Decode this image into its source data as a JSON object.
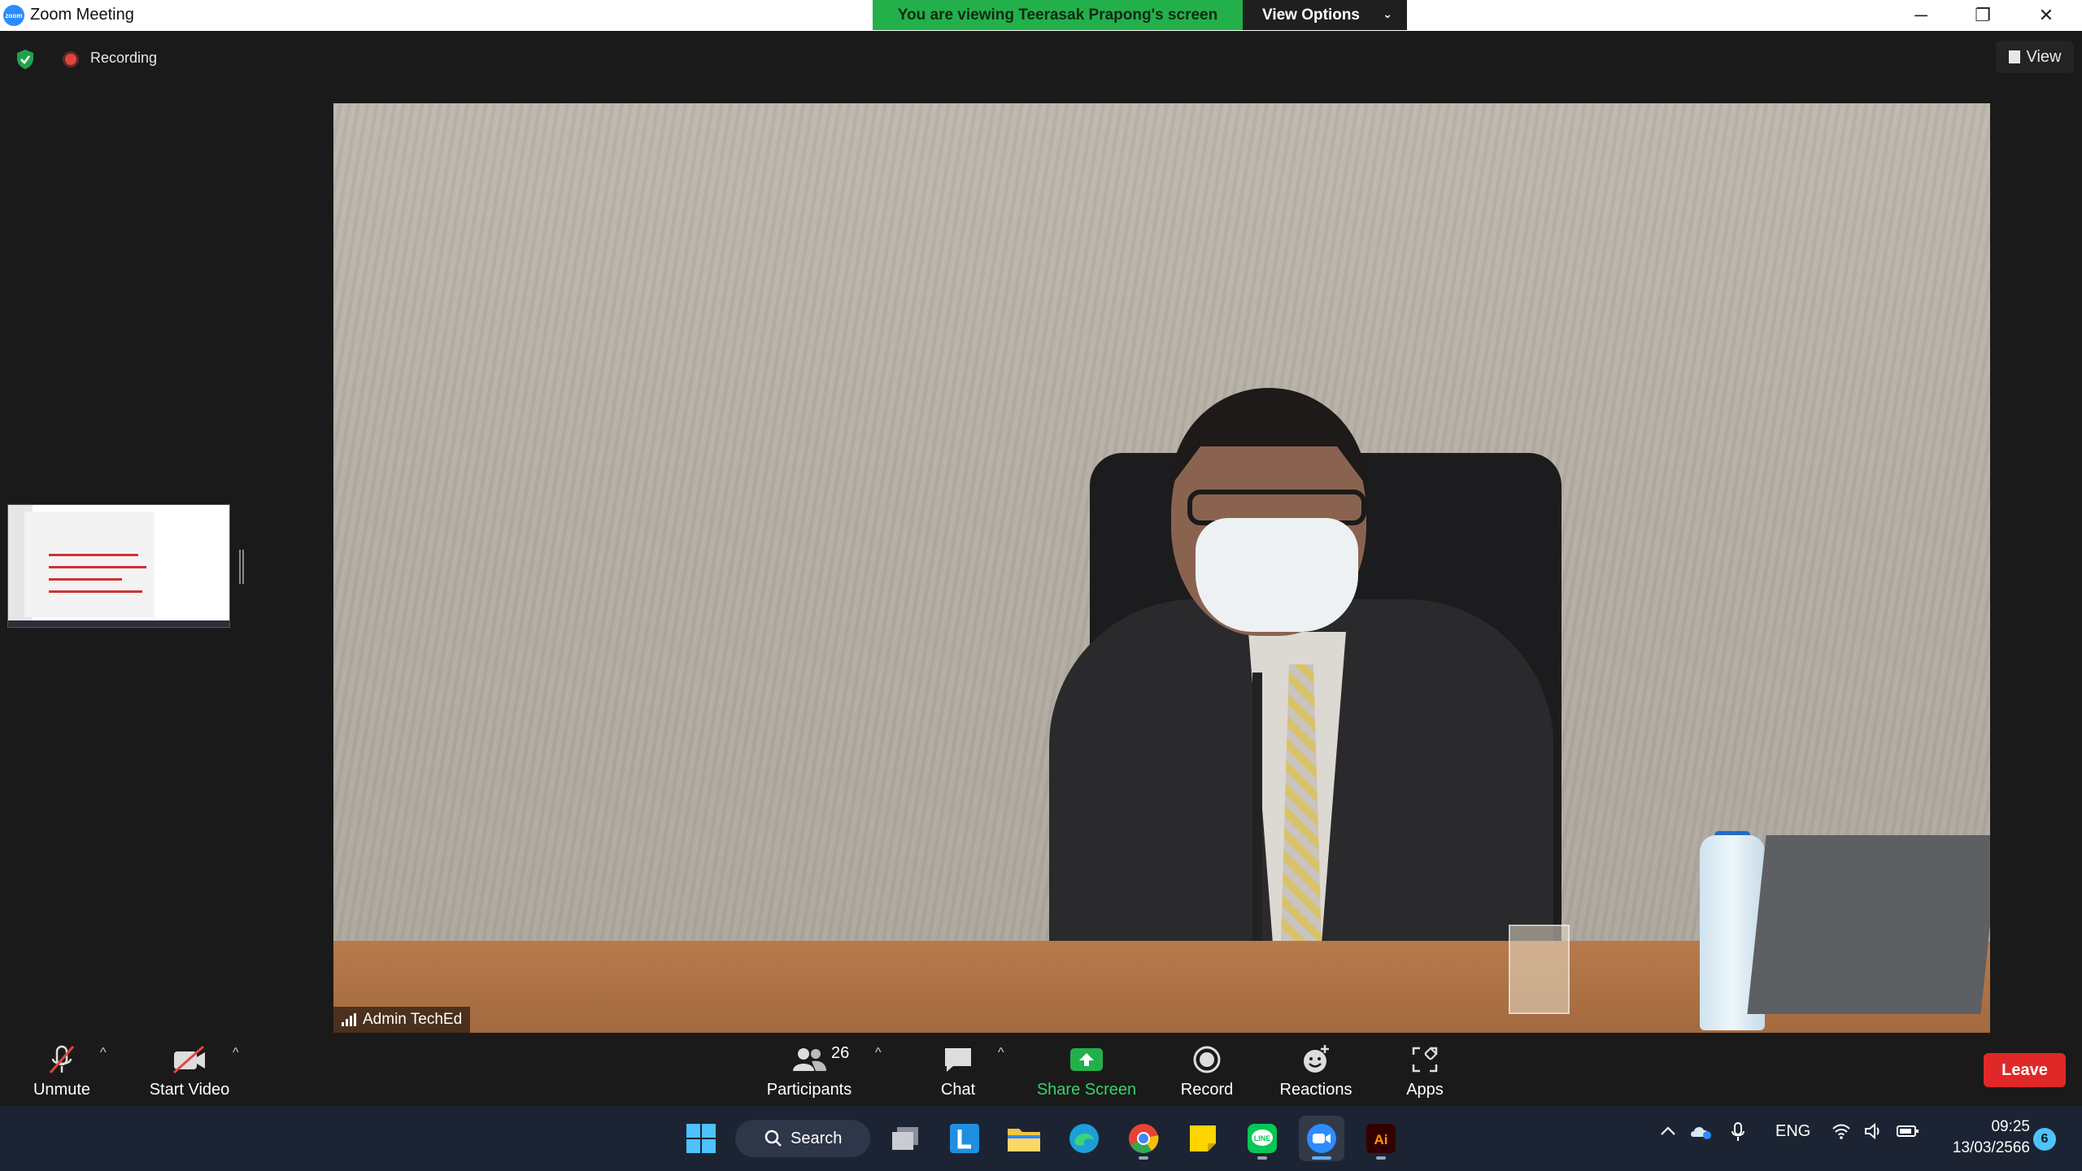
{
  "window": {
    "title": "Zoom Meeting",
    "app_icon_text": "zoom",
    "minimize_glyph": "─",
    "restore_glyph": "❐",
    "close_glyph": "✕"
  },
  "banner": {
    "viewing_text": "You are viewing Teerasak Prapong's screen",
    "view_options_label": "View Options",
    "view_options_color": "#23b04a"
  },
  "topbar": {
    "recording_label": "Recording",
    "view_button_label": "View"
  },
  "video": {
    "participant_name": "Admin TechEd"
  },
  "toolbar": {
    "unmute_label": "Unmute",
    "start_video_label": "Start Video",
    "participants_label": "Participants",
    "participants_count": "26",
    "chat_label": "Chat",
    "share_screen_label": "Share Screen",
    "record_label": "Record",
    "reactions_label": "Reactions",
    "apps_label": "Apps",
    "leave_label": "Leave",
    "caret_glyph": "^"
  },
  "taskbar": {
    "search_label": "Search",
    "language": "ENG",
    "time": "09:25",
    "date": "13/03/2566",
    "notification_count": "6",
    "apps": [
      "windows-start",
      "task-view",
      "l-app",
      "file-explorer",
      "edge",
      "chrome",
      "sticky-notes",
      "line",
      "zoom",
      "adobe-illustrator"
    ]
  },
  "colors": {
    "leave": "#e02828",
    "share_green": "#35d36a",
    "taskbar_bg": "#1c2433"
  }
}
